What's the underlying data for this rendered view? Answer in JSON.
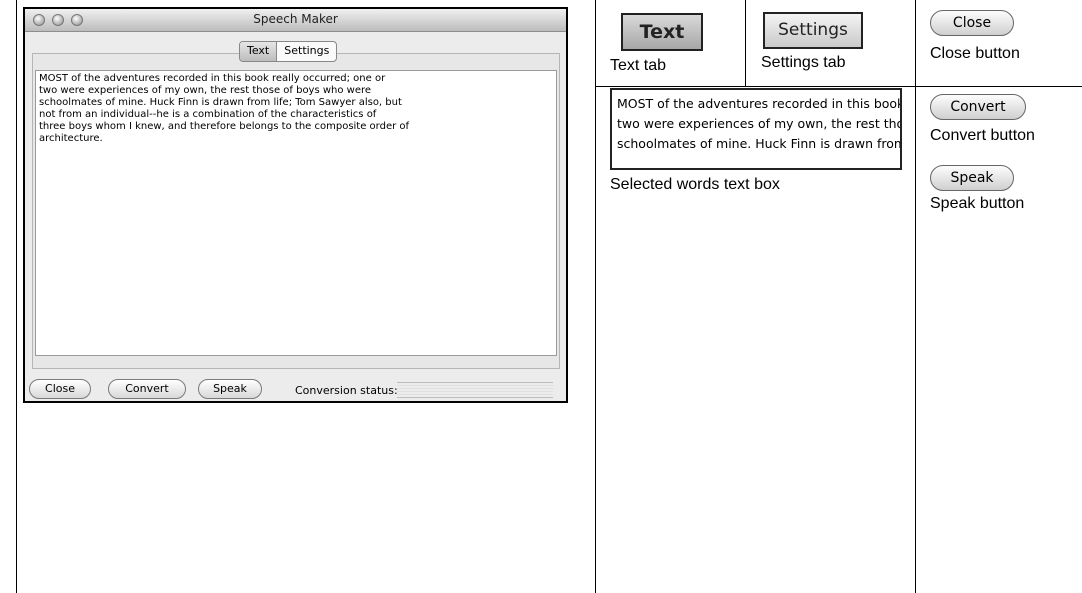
{
  "window": {
    "title": "Speech Maker",
    "tabs": [
      "Text",
      "Settings"
    ],
    "selected_tab": "Text",
    "text": "MOST of the adventures recorded in this book really occurred; one or\ntwo were experiences of my own, the rest those of boys who were\nschoolmates of mine. Huck Finn is drawn from life; Tom Sawyer also, but\nnot from an individual--he is a combination of the characteristics of\nthree boys whom I knew, and therefore belongs to the composite order of\narchitecture.",
    "buttons": {
      "close": "Close",
      "convert": "Convert",
      "speak": "Speak"
    },
    "status_label": "Conversion status:"
  },
  "annotations": {
    "text_tab": {
      "zoom_label": "Text",
      "caption": "Text tab"
    },
    "settings_tab": {
      "zoom_label": "Settings",
      "caption": "Settings tab"
    },
    "close_button": {
      "zoom_label": "Close",
      "caption": "Close button"
    },
    "text_box": {
      "zoom_text": "MOST of the adventures recorded in this book r\ntwo were experiences of my own, the rest those\nschoolmates of mine. Huck Finn is drawn from",
      "caption": "Selected words text box"
    },
    "convert_button": {
      "zoom_label": "Convert",
      "caption": "Convert button"
    },
    "speak_button": {
      "zoom_label": "Speak",
      "caption": "Speak button"
    }
  }
}
